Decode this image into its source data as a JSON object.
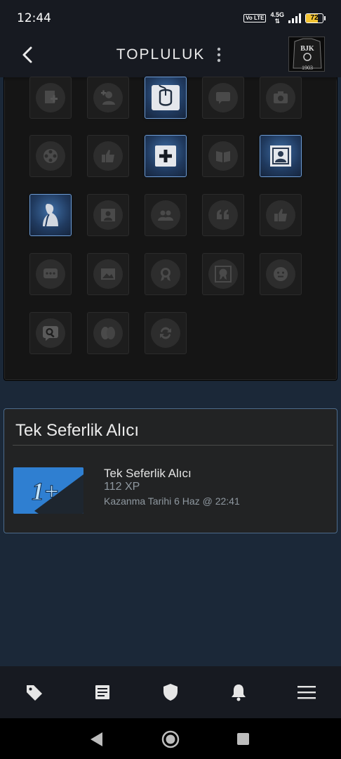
{
  "status_bar": {
    "time": "12:44",
    "volte": "Vo LTE",
    "network": "4.5G",
    "battery": "72",
    "battery_level": 0.72
  },
  "header": {
    "title": "TOPLULUK",
    "back_icon": "chevron-left-icon",
    "more_icon": "vertical-ellipsis-icon"
  },
  "avatar": {
    "text_top": "BJK",
    "text_bottom": "1903"
  },
  "badge_grid": {
    "slots": [
      {
        "icon": "add-document-icon",
        "active": false
      },
      {
        "icon": "add-friend-icon",
        "active": false
      },
      {
        "icon": "mouse-icon",
        "active": true
      },
      {
        "icon": "chat-bubble-icon",
        "active": false
      },
      {
        "icon": "camera-icon",
        "active": false
      },
      {
        "icon": "film-reel-icon",
        "active": false
      },
      {
        "icon": "thumbs-up-icon",
        "active": false
      },
      {
        "icon": "plus-icon",
        "active": true
      },
      {
        "icon": "book-icon",
        "active": false
      },
      {
        "icon": "profile-picture-icon",
        "active": true
      },
      {
        "icon": "profile-silhouette-icon",
        "active": true
      },
      {
        "icon": "profile-picture-icon",
        "active": false
      },
      {
        "icon": "group-icon",
        "active": false
      },
      {
        "icon": "quote-icon",
        "active": false
      },
      {
        "icon": "thumbs-up-icon",
        "active": false
      },
      {
        "icon": "chat-dots-icon",
        "active": false
      },
      {
        "icon": "screenshot-icon",
        "active": false
      },
      {
        "icon": "award-icon",
        "active": false
      },
      {
        "icon": "framed-award-icon",
        "active": false
      },
      {
        "icon": "emoticon-icon",
        "active": false
      },
      {
        "icon": "search-icon",
        "active": false
      },
      {
        "icon": "coins-icon",
        "active": false
      },
      {
        "icon": "trade-icon",
        "active": false
      }
    ]
  },
  "achievement": {
    "section_title": "Tek Seferlik Alıcı",
    "name": "Tek Seferlik Alıcı",
    "xp": "112 XP",
    "date": "Kazanma Tarihi 6 Haz @ 22:41",
    "icon_text": "1+"
  },
  "bottom_nav": [
    {
      "icon": "tag-icon"
    },
    {
      "icon": "news-icon"
    },
    {
      "icon": "shield-icon"
    },
    {
      "icon": "bell-icon"
    },
    {
      "icon": "menu-icon"
    }
  ],
  "colors": {
    "background": "#1b2838",
    "bar": "#171a21",
    "accent": "#6d9bd3",
    "active_badge": "#2f5a8c"
  }
}
